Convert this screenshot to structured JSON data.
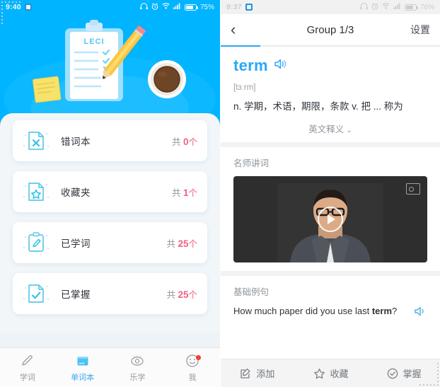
{
  "left_phone": {
    "statusbar": {
      "time": "9:40",
      "battery_pct": "75%",
      "icons": [
        "headphone-icon",
        "alarm-icon",
        "wifi-icon",
        "signal-icon",
        "battery-icon"
      ]
    },
    "illustration": {
      "clipboard_label": "LECI",
      "alt": "clipboard with checklist, pencil, sticky note and coffee cup"
    },
    "cards": [
      {
        "icon": "document-x-icon",
        "label": "错词本",
        "prefix": "共 ",
        "count": "0",
        "unit": "个"
      },
      {
        "icon": "document-star-icon",
        "label": "收藏夹",
        "prefix": "共 ",
        "count": "1",
        "unit": "个"
      },
      {
        "icon": "clipboard-pen-icon",
        "label": "已学词",
        "prefix": "共 ",
        "count": "25",
        "unit": "个"
      },
      {
        "icon": "document-check-icon",
        "label": "已掌握",
        "prefix": "共 ",
        "count": "25",
        "unit": "个"
      }
    ],
    "tabbar": [
      {
        "icon": "pen-icon",
        "label": "学词",
        "active": false
      },
      {
        "icon": "notebook-icon",
        "label": "单词本",
        "active": true
      },
      {
        "icon": "eye-icon",
        "label": "乐学",
        "active": false
      },
      {
        "icon": "smiley-icon",
        "label": "我",
        "active": false,
        "badge": true
      }
    ]
  },
  "right_phone": {
    "statusbar": {
      "time": "9:37",
      "battery_pct": "76%",
      "icons": [
        "headphone-icon",
        "alarm-icon",
        "wifi-icon",
        "signal-icon",
        "battery-icon"
      ]
    },
    "navbar": {
      "back": "‹",
      "title": "Group 1/3",
      "action": "设置"
    },
    "progress": "18%",
    "word": {
      "text": "term",
      "speaker_icon": "speaker-icon",
      "phonetic": "[tɜːrm]",
      "meaning": "n. 学期，术语，期限，条款 v. 把 ... 称为",
      "en_def_label": "英文释义",
      "en_def_chevron": "⌄"
    },
    "video_section": {
      "title": "名师讲词",
      "play_icon": "play-icon",
      "badge_icon": "video-quality-icon"
    },
    "sentence_section": {
      "title": "基础例句",
      "text_before": "How much paper did you use last ",
      "text_bold": "term",
      "text_after": "?",
      "speaker_icon": "speaker-icon"
    },
    "actionbar": [
      {
        "icon": "add-note-icon",
        "label": "添加"
      },
      {
        "icon": "star-icon",
        "label": "收藏"
      },
      {
        "icon": "check-circle-icon",
        "label": "掌握"
      }
    ]
  },
  "colors": {
    "brand_blue": "#00b4ff",
    "accent_blue": "#2ba7f5",
    "count_pink": "#f2607f",
    "badge_red": "#f53b2f"
  }
}
